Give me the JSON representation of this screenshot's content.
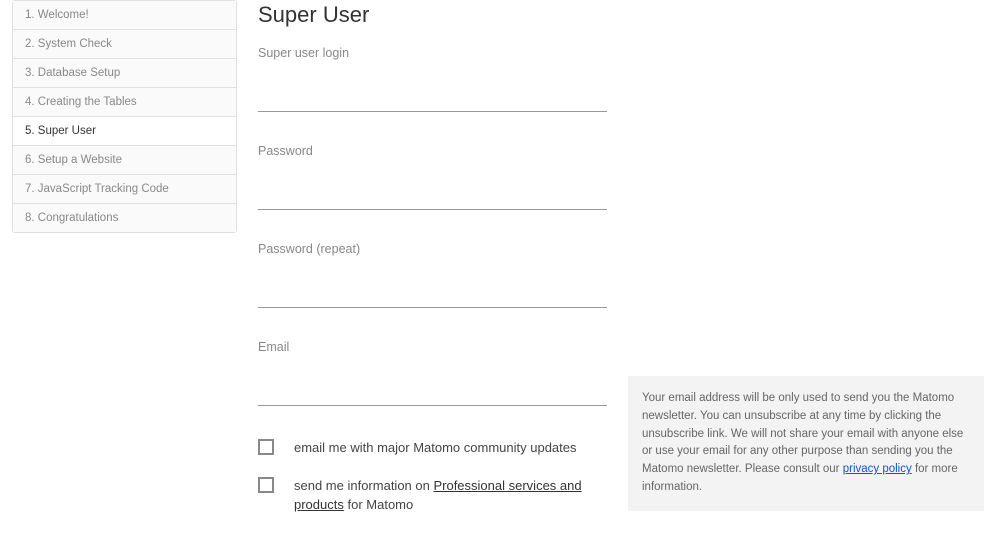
{
  "sidebar": {
    "items": [
      {
        "label": "1. Welcome!"
      },
      {
        "label": "2. System Check"
      },
      {
        "label": "3. Database Setup"
      },
      {
        "label": "4. Creating the Tables"
      },
      {
        "label": "5. Super User"
      },
      {
        "label": "6. Setup a Website"
      },
      {
        "label": "7. JavaScript Tracking Code"
      },
      {
        "label": "8. Congratulations"
      }
    ],
    "active_index": 4
  },
  "form": {
    "title": "Super User",
    "login_label": "Super user login",
    "password_label": "Password",
    "password_repeat_label": "Password (repeat)",
    "email_label": "Email",
    "checkbox1_text": "email me with major Matomo community updates",
    "checkbox2_prefix": "send me information on ",
    "checkbox2_link": "Professional services and products",
    "checkbox2_suffix": " for Matomo"
  },
  "notice": {
    "text_before": "Your email address will be only used to send you the Matomo newsletter. You can unsubscribe at any time by clicking the unsubscribe link. We will not share your email with anyone else or use your email for any other purpose than sending you the Matomo newsletter. Please consult our ",
    "link_text": "privacy policy",
    "text_after": " for more information."
  }
}
